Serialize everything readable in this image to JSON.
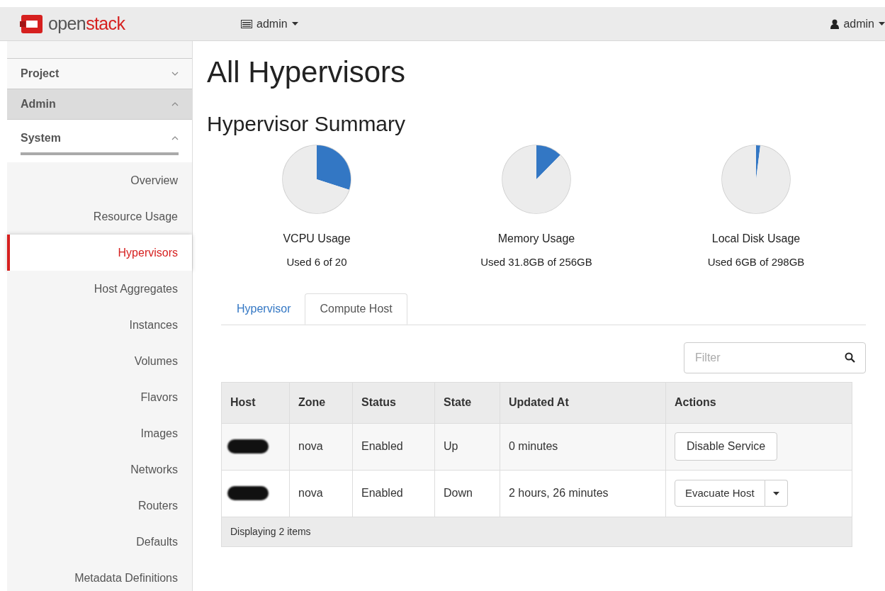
{
  "topbar": {
    "logo_prefix": "open",
    "logo_suffix": "stack",
    "project_menu": "admin",
    "user_menu": "admin"
  },
  "sidebar": {
    "sections": [
      {
        "label": "Project",
        "expanded": false,
        "selected": false
      },
      {
        "label": "Admin",
        "expanded": true,
        "selected": true
      }
    ],
    "group": {
      "label": "System",
      "expanded": true
    },
    "items": [
      {
        "label": "Overview",
        "selected": false
      },
      {
        "label": "Resource Usage",
        "selected": false
      },
      {
        "label": "Hypervisors",
        "selected": true
      },
      {
        "label": "Host Aggregates",
        "selected": false
      },
      {
        "label": "Instances",
        "selected": false
      },
      {
        "label": "Volumes",
        "selected": false
      },
      {
        "label": "Flavors",
        "selected": false
      },
      {
        "label": "Images",
        "selected": false
      },
      {
        "label": "Networks",
        "selected": false
      },
      {
        "label": "Routers",
        "selected": false
      },
      {
        "label": "Defaults",
        "selected": false
      },
      {
        "label": "Metadata Definitions",
        "selected": false
      }
    ]
  },
  "page_title": "All Hypervisors",
  "summary": {
    "title": "Hypervisor Summary",
    "meters": [
      {
        "label": "VCPU Usage",
        "reading": "Used 6 of 20",
        "chart_data": {
          "type": "pie",
          "values": [
            30,
            70
          ]
        }
      },
      {
        "label": "Memory Usage",
        "reading": "Used 31.8GB of 256GB",
        "chart_data": {
          "type": "pie",
          "values": [
            12.4,
            87.6
          ]
        }
      },
      {
        "label": "Local Disk Usage",
        "reading": "Used 6GB of 298GB",
        "chart_data": {
          "type": "pie",
          "values": [
            2,
            98
          ]
        }
      }
    ]
  },
  "tabs": [
    {
      "label": "Hypervisor",
      "selected": false
    },
    {
      "label": "Compute Host",
      "selected": true
    }
  ],
  "filter": {
    "placeholder": "Filter"
  },
  "table": {
    "columns": [
      "Host",
      "Zone",
      "Status",
      "State",
      "Updated At",
      "Actions"
    ],
    "rows": [
      {
        "host_redacted": true,
        "zone": "nova",
        "status": "Enabled",
        "state": "Up",
        "updated": "0 minutes",
        "action": "Disable Service",
        "action_menu": false
      },
      {
        "host_redacted": true,
        "zone": "nova",
        "status": "Enabled",
        "state": "Down",
        "updated": "2 hours, 26 minutes",
        "action": "Evacuate Host",
        "action_menu": true
      }
    ],
    "footer": "Displaying 2 items"
  }
}
